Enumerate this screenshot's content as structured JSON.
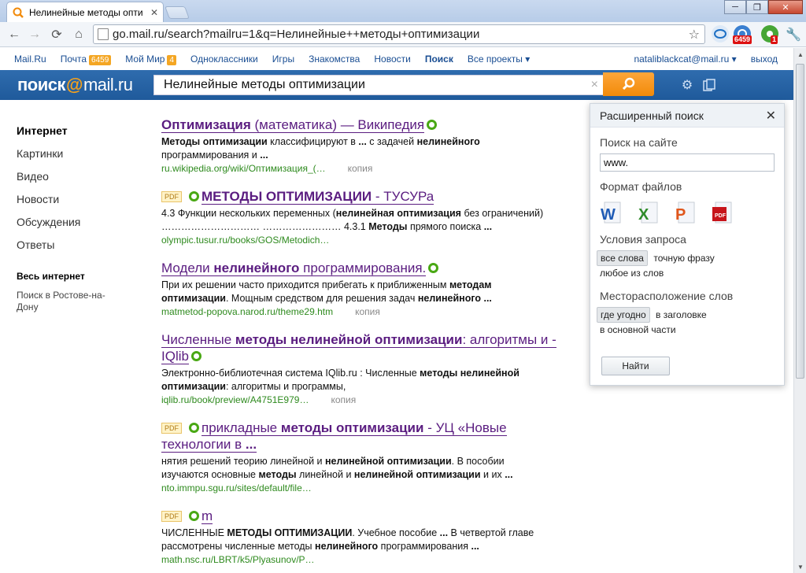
{
  "browser": {
    "tab_title": "Нелинейные методы опти",
    "url": "go.mail.ru/search?mailru=1&q=Нелинейные++методы+оптимизации",
    "ext_badge_1": "6459",
    "ext_badge_2": "1"
  },
  "portal": {
    "links": [
      "Mail.Ru",
      "Почта",
      "Мой Мир",
      "Одноклассники",
      "Игры",
      "Знакомства",
      "Новости",
      "Поиск",
      "Все проекты ▾"
    ],
    "mail_count": "6459",
    "mir_count": "4",
    "user": "nataliblackcat@mail.ru ▾",
    "logout": "выход"
  },
  "search": {
    "logo_left": "поиск",
    "logo_at": "@",
    "logo_right": "mail.ru",
    "query": "Нелинейные  методы оптимизации",
    "clear": "×"
  },
  "sidebar": {
    "items": [
      "Интернет",
      "Картинки",
      "Видео",
      "Новости",
      "Обсуждения",
      "Ответы"
    ],
    "region_title": "Весь интернет",
    "region_sub": "Поиск в Ростове-на-Дону"
  },
  "results": [
    {
      "t1": "Оптимизация",
      "t2": " (математика) — Википедия",
      "s1": "Методы оптимизации",
      "s2": " классифицируют в ",
      "s3": "...",
      "s4": " с задачей ",
      "s5": "нелинейного",
      "s6": "программирования и ",
      "s7": "...",
      "url": "ru.wikipedia.org/wiki/Оптимизация_(…",
      "copy": "копия"
    },
    {
      "pdf": "PDF",
      "t1": "МЕТОДЫ ОПТИМИЗАЦИИ",
      "t2": " - ТУСУРа",
      "s1": "4.3 Функции нескольких переменных (",
      "s2": "нелинейная оптимизация",
      "s3": " без ограничений)",
      "s4": "…………………………  …………………… 4.3.1 ",
      "s5": "Методы",
      "s6": " прямого поиска ",
      "s7": "...",
      "url": "olympic.tusur.ru/books/GOS/Metodich…"
    },
    {
      "t1": "Модели ",
      "t2": "нелинейного",
      "t3": " программирования.",
      "s1": "При их решении часто приходится прибегать к приближенным ",
      "s2": "методам",
      "s3": "оптимизации",
      "s4": ". Мощным средством для решения задач ",
      "s5": "нелинейного",
      "s6": " ...",
      "url": "matmetod-popova.narod.ru/theme29.htm",
      "copy": "копия"
    },
    {
      "t1": "Численные ",
      "t2": "методы нелинейной оптимизации",
      "t3": ": алгоритмы и -",
      "t4": "IQlib",
      "s1": "Электронно-библиотечная система IQlib.ru : Численные ",
      "s2": "методы нелинейной",
      "s3": "оптимизации",
      "s4": ": алгоритмы и программы,",
      "url": "iqlib.ru/book/preview/A4751E979…",
      "copy": "копия"
    },
    {
      "pdf": "PDF",
      "t1": "прикладные ",
      "t2": "методы оптимизации",
      "t3": " - УЦ «Новые",
      "t4": "технологии в ",
      "t5": "...",
      "s1": "нятия решений теорию линейной и ",
      "s2": "нелинейной оптимизации",
      "s3": ". В пособии",
      "s4": "изучаются основные ",
      "s5": "методы",
      "s6": " линейной и ",
      "s7": "нелинейной оптимизации",
      "s8": " и их ",
      "s9": "...",
      "url": "nto.immpu.sgu.ru/sites/default/file…"
    },
    {
      "pdf": "PDF",
      "t1": "m",
      "s1": "ЧИСЛЕННЫЕ ",
      "s2": "МЕТОДЫ ОПТИМИЗАЦИИ",
      "s3": ". Учебное пособие ",
      "s4": "...",
      "s5": " В четвертой главе",
      "s6": "рассмотрены численные методы ",
      "s7": "нелинейного",
      "s8": " программирования ",
      "s9": "...",
      "url": "math.nsc.ru/LBRT/k5/Plyasunov/P…"
    }
  ],
  "advanced": {
    "title": "Расширенный поиск",
    "site_label": "Поиск на сайте",
    "site_value": "www.",
    "formats_label": "Формат файлов",
    "formats": [
      "W",
      "X",
      "P",
      "PDF"
    ],
    "query_label": "Условия запроса",
    "query_opts": [
      "все слова",
      "точную фразу",
      "любое из слов"
    ],
    "place_label": "Месторасположение слов",
    "place_opts": [
      "где угодно",
      "в заголовке",
      "в основной части"
    ],
    "find": "Найти"
  },
  "colors": {
    "header_blue": "#2f6cae",
    "search_orange": "#f28a09",
    "title_purple": "#5a1c80",
    "url_green": "#2e8a1e"
  }
}
